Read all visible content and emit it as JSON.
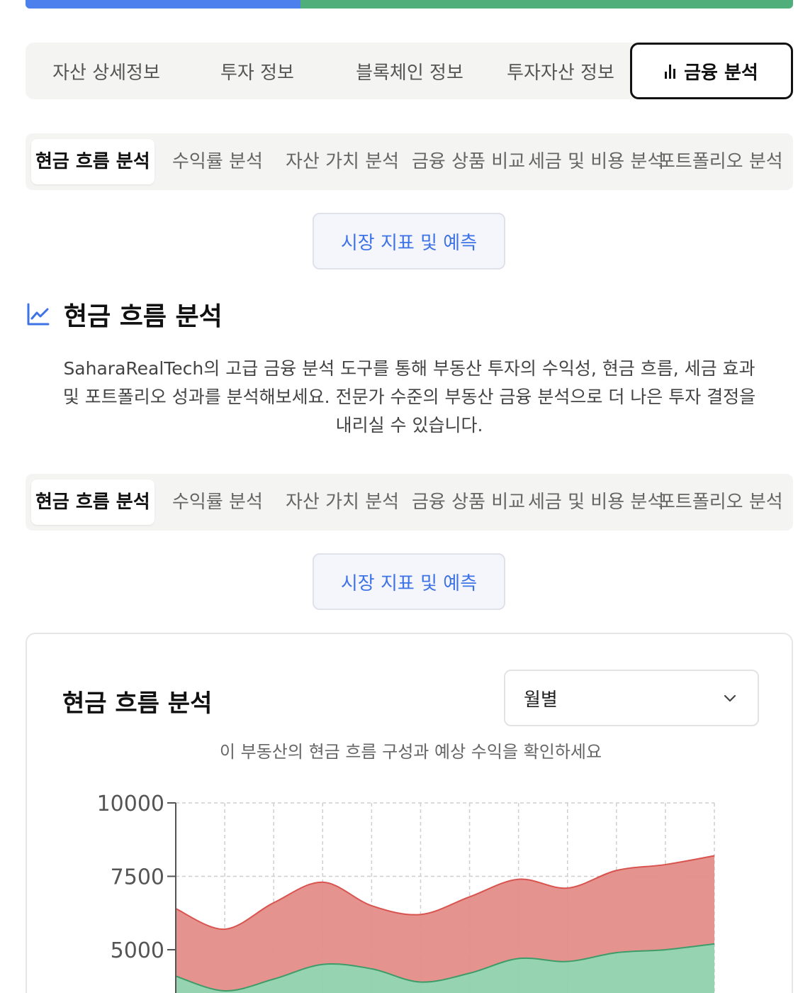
{
  "progress": {
    "fraction": 0.358,
    "colors": [
      "#4c80ec",
      "#4fae7a"
    ]
  },
  "main_tabs": {
    "items": [
      "자산 상세정보",
      "투자 정보",
      "블록체인 정보",
      "투자자산 정보",
      "금융 분석"
    ],
    "active": "금융 분석",
    "active_icon": "bar-chart-icon"
  },
  "sub_tabs": {
    "items": [
      "현금 흐름 분석",
      "수익률 분석",
      "자산 가치 분석",
      "금융 상품 비교",
      "세금 및 비용 분석",
      "포트폴리오 분석"
    ],
    "active": "현금 흐름 분석"
  },
  "market_button": {
    "label": "시장 지표 및 예측"
  },
  "section": {
    "title": "현금 흐름 분석",
    "icon": "line-chart-icon",
    "description_lines": [
      "SaharaRealTech의 고급 금융 분석 도구를 통해 부동산 투자의 수익성, 현금 흐름, 세금 효과",
      "및 포트폴리오 성과를 분석해보세요. 전문가 수준의 부동산 금융 분석으로 더 나은 투자 결정을",
      "내리실 수 있습니다."
    ]
  },
  "card": {
    "title": "현금 흐름 분석",
    "period_select": {
      "value": "월별",
      "icon": "chevron-down-icon"
    },
    "subtitle": "이 부동산의 현금 흐름 구성과 예상 수익을 확인하세요"
  },
  "chart_data": {
    "type": "area",
    "stacked": true,
    "x_count": 12,
    "ylim": [
      0,
      10000
    ],
    "yticks": [
      10000,
      7500,
      5000
    ],
    "grid": true,
    "series": [
      {
        "values": [
          4100,
          3600,
          4000,
          4500,
          4350,
          3900,
          4200,
          4700,
          4600,
          4900,
          5000,
          5200
        ],
        "color": "#8fd1ad",
        "stroke": "#3e9c69"
      },
      {
        "values": [
          6400,
          5700,
          6600,
          7300,
          6500,
          6200,
          6800,
          7400,
          7100,
          7700,
          7900,
          8200
        ],
        "color": "#e48d88",
        "stroke": "#d9534f"
      }
    ]
  }
}
